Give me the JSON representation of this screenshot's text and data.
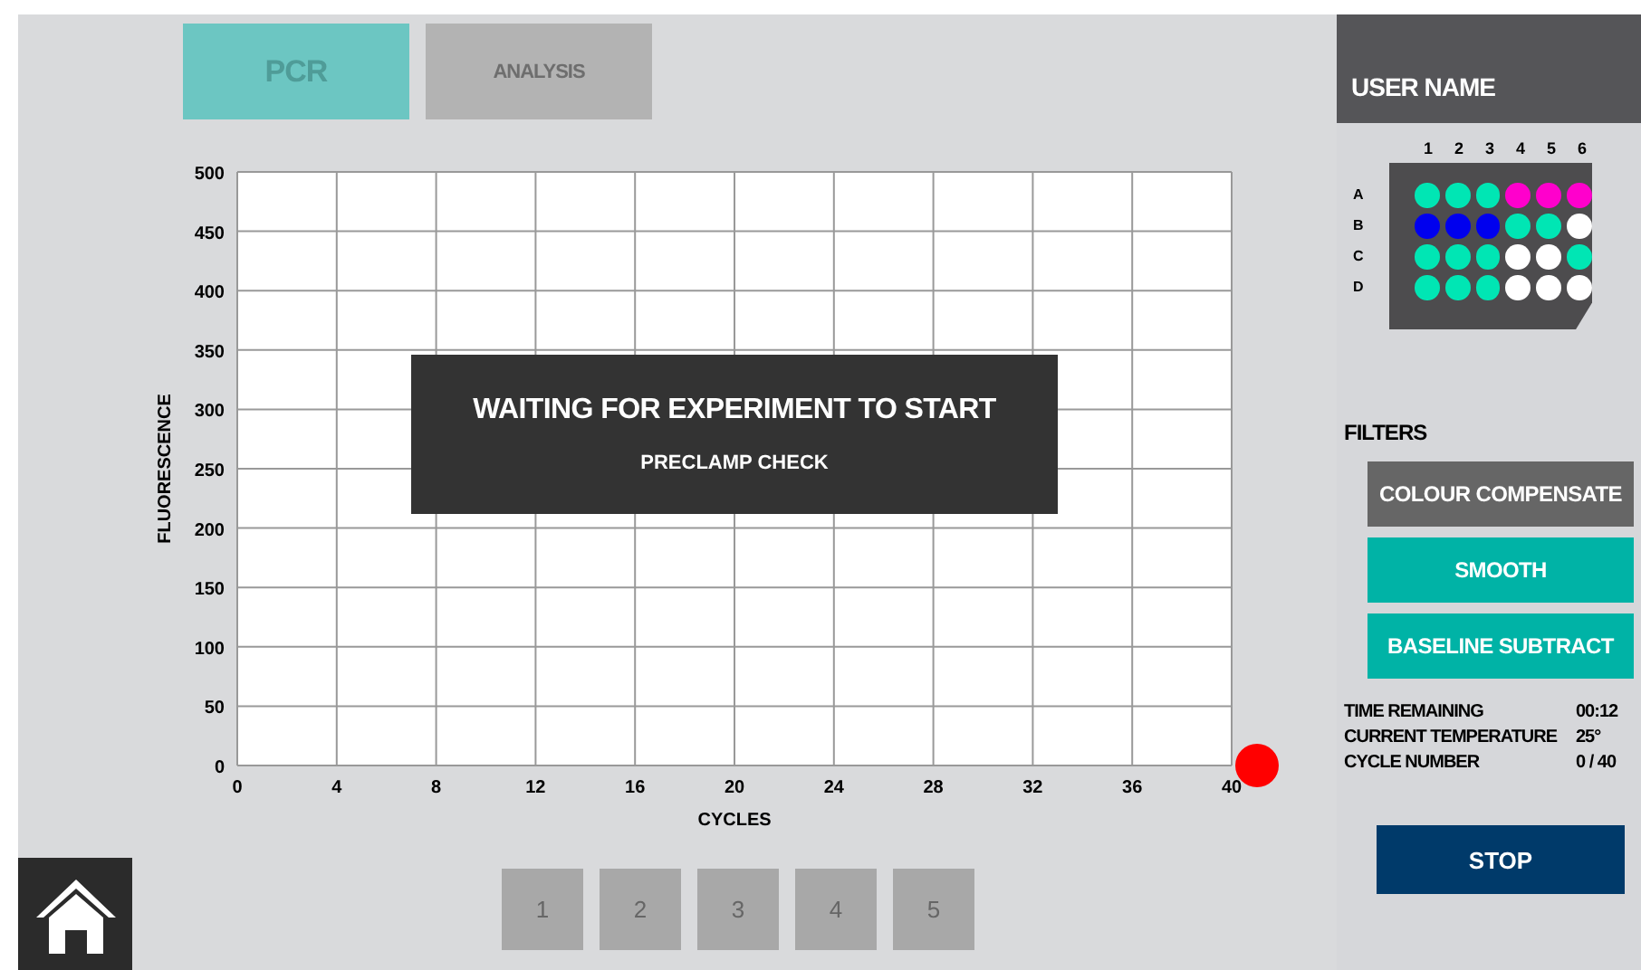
{
  "tabs": [
    {
      "label": "PCR",
      "selected": true
    },
    {
      "label": "ANALYSIS",
      "selected": false
    }
  ],
  "chart": {
    "chart_data": {
      "type": "line",
      "grid": true,
      "xlabel": "CYCLES",
      "ylabel": "FLUORESCENCE",
      "xlim": [
        0,
        40
      ],
      "ylim": [
        0,
        500
      ],
      "xticks": [
        0,
        4,
        8,
        12,
        16,
        20,
        24,
        28,
        32,
        36,
        40
      ],
      "yticks": [
        0,
        50,
        100,
        150,
        200,
        250,
        300,
        350,
        400,
        450,
        500
      ]
    },
    "overlay": {
      "title": "WAITING FOR EXPERIMENT TO START",
      "subtitle": "PRECLAMP CHECK"
    },
    "status_light": {
      "on": true
    }
  },
  "pages": [
    {
      "label": "1",
      "selected": false
    },
    {
      "label": "2",
      "selected": false
    },
    {
      "label": "3",
      "selected": false
    },
    {
      "label": "4",
      "selected": false
    },
    {
      "label": "5",
      "selected": false
    }
  ],
  "user": {
    "name": "USER NAME"
  },
  "plate": {
    "columns": [
      "1",
      "2",
      "3",
      "4",
      "5",
      "6"
    ],
    "rows": [
      {
        "label": "A",
        "wells": [
          {
            "color": "#00e6b4"
          },
          {
            "color": "#00e6b4"
          },
          {
            "color": "#00e6b4"
          },
          {
            "color": "#ff00cc"
          },
          {
            "color": "#ff00cc"
          },
          {
            "color": "#ff00cc"
          }
        ]
      },
      {
        "label": "B",
        "wells": [
          {
            "color": "#0000ee"
          },
          {
            "color": "#0000ee"
          },
          {
            "color": "#0000ee"
          },
          {
            "color": "#00e6b4"
          },
          {
            "color": "#00e6b4"
          },
          {
            "color": "#ffffff"
          }
        ]
      },
      {
        "label": "C",
        "wells": [
          {
            "color": "#00e6b4"
          },
          {
            "color": "#00e6b4"
          },
          {
            "color": "#00e6b4"
          },
          {
            "color": "#ffffff"
          },
          {
            "color": "#ffffff"
          },
          {
            "color": "#00e6b4"
          }
        ]
      },
      {
        "label": "D",
        "wells": [
          {
            "color": "#00e6b4"
          },
          {
            "color": "#00e6b4"
          },
          {
            "color": "#00e6b4"
          },
          {
            "color": "#ffffff"
          },
          {
            "color": "#ffffff"
          },
          {
            "color": "#ffffff"
          }
        ]
      }
    ]
  },
  "filters": {
    "title": "FILTERS",
    "items": [
      {
        "label": "COLOUR COMPENSATE",
        "on": false
      },
      {
        "label": "SMOOTH",
        "on": true
      },
      {
        "label": "BASELINE SUBTRACT",
        "on": true
      }
    ]
  },
  "status": [
    {
      "label": "TIME REMAINING",
      "value": "00:12"
    },
    {
      "label": "CURRENT TEMPERATURE",
      "value": "25°"
    },
    {
      "label": "CYCLE NUMBER",
      "value": "0 / 40"
    }
  ],
  "stop_button": "STOP"
}
